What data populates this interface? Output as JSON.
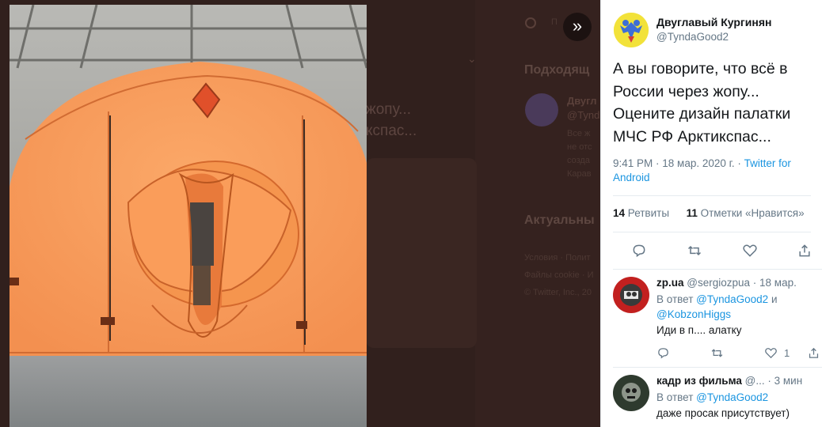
{
  "background_page": {
    "sidebar_heading_suggested": "Подходящ",
    "sidebar_heading_trending": "Актуальны",
    "snippet_line1": "жопу...",
    "snippet_line2": "кспас...",
    "bg_user_name": "Двугл",
    "bg_user_handle": "@Tynd",
    "bg_bio_1": "Все ж",
    "bg_bio_2": "не отс",
    "bg_bio_3": "созда",
    "bg_bio_4": "Карав",
    "bg_footer_1": "Условия · Полит",
    "bg_footer_2": "Файлы cookie · И",
    "bg_footer_3": "© Twitter, Inc., 20",
    "search_placeholder": "П"
  },
  "viewer": {
    "next_button_icon": "double-chevron-right-icon",
    "next_label": "»"
  },
  "tweet": {
    "author_name": "Двуглавый Кургинян",
    "author_handle": "@TyndaGood2",
    "text": "А вы говорите, что всё в России через жопу... Оцените дизайн палатки МЧС РФ Арктикспас...",
    "time": "9:41 PM · 18 мар. 2020 г. · ",
    "source": "Twitter for Android",
    "retweets_count": "14",
    "retweets_label": " Ретвиты",
    "likes_count": "11",
    "likes_label": " Отметки «Нравится»",
    "actions": {
      "reply_icon": "reply-icon",
      "retweet_icon": "retweet-icon",
      "like_icon": "heart-icon",
      "share_icon": "share-icon"
    }
  },
  "replies": [
    {
      "name": "zp.ua",
      "handle": "@sergiozpua",
      "time": " · 18 мар.",
      "reply_prefix": "В ответ ",
      "mention_1": "@TyndaGood2",
      "connector": " и ",
      "mention_2": "@KobzonHiggs",
      "text": "Иди в п.... алатку",
      "like_count": "1"
    },
    {
      "name": "кадр из фильма",
      "handle": "@...",
      "time": " · 3 мин",
      "reply_prefix": "В ответ ",
      "mention_1": "@TyndaGood2",
      "text": "даже просак присутствует)"
    }
  ],
  "colors": {
    "accent": "#1b95e0",
    "secondary_text": "#657786",
    "primary_text": "#14171a",
    "tent_orange": "#f79a5c"
  }
}
